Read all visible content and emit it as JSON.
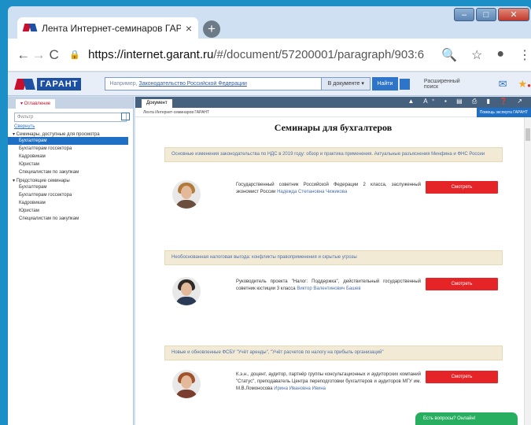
{
  "browser": {
    "tab_title": "Лента Интернет-семинаров ГАР",
    "tab_close": "×",
    "new_tab": "+",
    "nav_back": "←",
    "nav_forward": "→",
    "nav_reload": "C",
    "url_lock": "🔒",
    "url_host": "https://internet.garant.ru",
    "url_path": "/#/document/57200001/paragraph/903:6",
    "zoom_icon": "🔍",
    "star_icon": "☆",
    "profile_icon": "●",
    "menu_icon": "⋮",
    "window_min": "–",
    "window_max": "□",
    "window_close": "✕"
  },
  "garant": {
    "logo_word": "ГАРАНТ",
    "search_prefix": "Например,",
    "search_hint": "Законодательство Российской Федерации",
    "search_scope": "В документе ▾",
    "search_button": "Найти",
    "extended_search": "Расширенный поиск",
    "chat_badge": "●"
  },
  "sidebar": {
    "tab": "▾ Оглавление",
    "filter_placeholder": "Фильтр",
    "reset": "Свернуть",
    "groups": [
      {
        "label": "▾ Семинары, доступные для просмотра",
        "items": [
          "Бухгалтерам",
          "Бухгалтерам госсектора",
          "Кадровикам",
          "Юристам",
          "Специалистам по закупкам"
        ]
      },
      {
        "label": "▾ Предстоящие семинары",
        "items": [
          "Бухгалтерам",
          "Бухгалтерам госсектора",
          "Кадровикам",
          "Юристам",
          "Специалистам по закупкам"
        ]
      }
    ]
  },
  "document": {
    "tab": "Документ",
    "breadcrumb": "Лента Интернет-семинаров ГАРАНТ",
    "toolbar_icons": "▲ A⁺ ▪ ▤ ⎙ ▮ ❓ ↗",
    "ask_expert": "Помощь эксперта ГАРАНТ",
    "title": "Семинары для бухгалтеров",
    "watch_label": "Смотреть",
    "seminars": [
      {
        "topic": "Основные изменения законодательства по НДС в 2019 году: обзор и практика применения. Актуальные разъяснения Минфина и ФНС России",
        "speaker_desc": "Государственный советник Российской Федерации 2 класса, заслуженный экономист России",
        "speaker_name": "Надежда Степановна Чижикова"
      },
      {
        "topic": "Необоснованная налоговая выгода: конфликты правоприменения и скрытые угрозы",
        "speaker_desc": "Руководитель проекта \"Налог: Поддержка\", действительный государственный советник юстиции 3 класса",
        "speaker_name": "Виктор Валентинович Башев"
      },
      {
        "topic": "Новые и обновленные ФСБУ \"Учёт аренды\", \"Учёт расчетов по налогу на прибыль организаций\"",
        "speaker_desc": "К.э.н., доцент, аудитор, партнёр группы консультационных и аудиторских компаний \"Статус\", преподаватель Центра переподготовки бухгалтеров и аудиторов МГУ им. М.В.Ломоносова",
        "speaker_name": "Ирина Ивановна Ивина"
      }
    ]
  },
  "chat": {
    "label": "Есть вопросы? Онлайн!"
  },
  "colors": {
    "accent": "#e52428",
    "link": "#4a6ea8",
    "highlight": "#1f6fc4"
  }
}
